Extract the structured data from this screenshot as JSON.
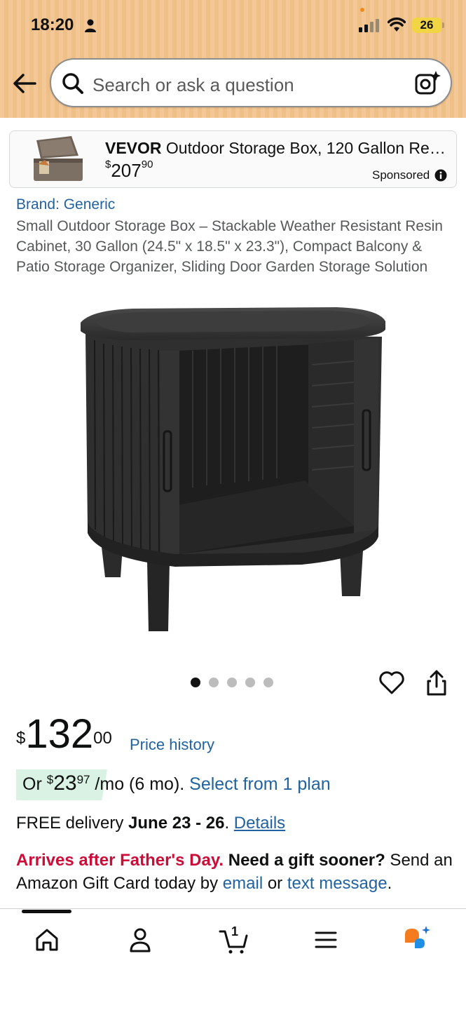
{
  "status_bar": {
    "time": "18:20",
    "battery": "26"
  },
  "search": {
    "placeholder": "Search or ask a question"
  },
  "sponsored_ad": {
    "brand": "VEVOR",
    "title_rest": " Outdoor Storage Box, 120 Gallon Re…",
    "price_currency": "$",
    "price_whole": "207",
    "price_fraction": "90",
    "sponsored_label": "Sponsored"
  },
  "product": {
    "brand_link": "Brand: Generic",
    "title": "Small Outdoor Storage Box – Stackable Weather Resistant Resin Cabinet, 30 Gallon (24.5\" x 18.5\" x 23.3\"), Compact Balcony & Patio Storage Organizer, Sliding Door Garden Storage Solution",
    "image_count": 5,
    "active_image": 1
  },
  "price": {
    "currency": "$",
    "whole": "132",
    "fraction": "00",
    "history_link": "Price history"
  },
  "plan": {
    "prefix": "Or ",
    "currency": "$",
    "whole": "23",
    "fraction": "97",
    "suffix": " /mo (6 mo). ",
    "link": "Select from 1 plan"
  },
  "delivery": {
    "prefix": "FREE delivery ",
    "dates": "June 23 - 26",
    "sep": ". ",
    "details_link": "Details"
  },
  "gift_notice": {
    "alert": "Arrives after Father's Day.",
    "question": " Need a gift sooner?",
    "text1": " Send an Amazon Gift Card today by ",
    "email_link": "email",
    "text2": " or ",
    "sms_link": "text message",
    "end": "."
  },
  "bottom_nav": {
    "cart_count": "1",
    "items": [
      "home-icon",
      "account-icon",
      "cart-icon",
      "menu-icon",
      "rufus-icon"
    ]
  },
  "colors": {
    "header_bg": "#f3c896",
    "link": "#2162a1",
    "alert_red": "#cc0c39",
    "plan_badge": "#d9f2e3"
  }
}
